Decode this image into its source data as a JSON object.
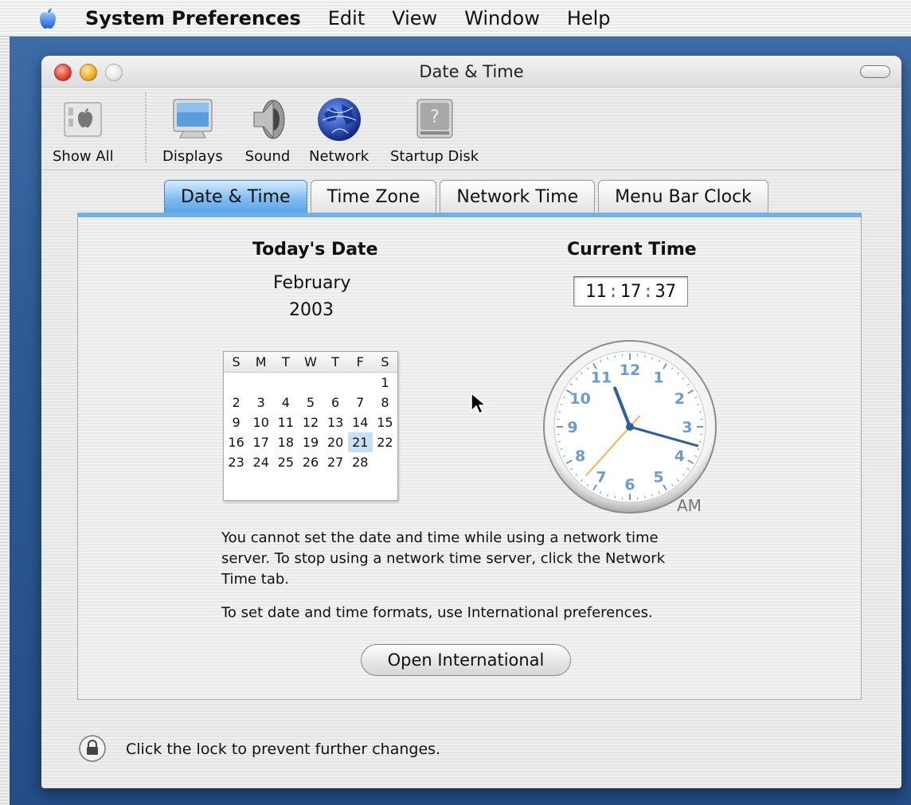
{
  "menubar": {
    "app_name": "System Preferences",
    "items": [
      "Edit",
      "View",
      "Window",
      "Help"
    ]
  },
  "window": {
    "title": "Date & Time"
  },
  "toolbar": {
    "items": [
      {
        "label": "Show All",
        "icon": "show-all-icon"
      },
      {
        "label": "Displays",
        "icon": "display-icon"
      },
      {
        "label": "Sound",
        "icon": "speaker-icon"
      },
      {
        "label": "Network",
        "icon": "globe-icon"
      },
      {
        "label": "Startup Disk",
        "icon": "hard-disk-icon"
      }
    ]
  },
  "tabs": [
    {
      "label": "Date & Time",
      "active": true
    },
    {
      "label": "Time Zone",
      "active": false
    },
    {
      "label": "Network Time",
      "active": false
    },
    {
      "label": "Menu Bar Clock",
      "active": false
    }
  ],
  "date": {
    "heading": "Today's Date",
    "month": "February",
    "year": "2003",
    "weekday_headers": [
      "S",
      "M",
      "T",
      "W",
      "T",
      "F",
      "S"
    ],
    "days": [
      "",
      "",
      "",
      "",
      "",
      "",
      "1",
      "2",
      "3",
      "4",
      "5",
      "6",
      "7",
      "8",
      "9",
      "10",
      "11",
      "12",
      "13",
      "14",
      "15",
      "16",
      "17",
      "18",
      "19",
      "20",
      "21",
      "22",
      "23",
      "24",
      "25",
      "26",
      "27",
      "28",
      ""
    ],
    "selected_day": "21"
  },
  "time": {
    "heading": "Current Time",
    "hours": "11",
    "minutes": "17",
    "seconds": "37",
    "separator": ":",
    "meridiem": "AM",
    "clock_numbers": [
      "12",
      "1",
      "2",
      "3",
      "4",
      "5",
      "6",
      "7",
      "8",
      "9",
      "10",
      "11"
    ]
  },
  "notes": {
    "line1": "You cannot set the date and time while using a network time",
    "line2": "server. To stop using a network time server, click the Network",
    "line3": "Time tab.",
    "formats": "To set date and time formats, use International preferences."
  },
  "open_international_button": "Open International",
  "lock": {
    "text": "Click the lock to prevent further changes.",
    "icon": "lock-icon"
  },
  "colors": {
    "active_tab": "#5aa4e6",
    "clock_numbers": "#6b9ccf",
    "hour_minute_hands": "#2f5f9a",
    "second_hand": "#f0b45a",
    "selected_day": "#c9dff5"
  }
}
